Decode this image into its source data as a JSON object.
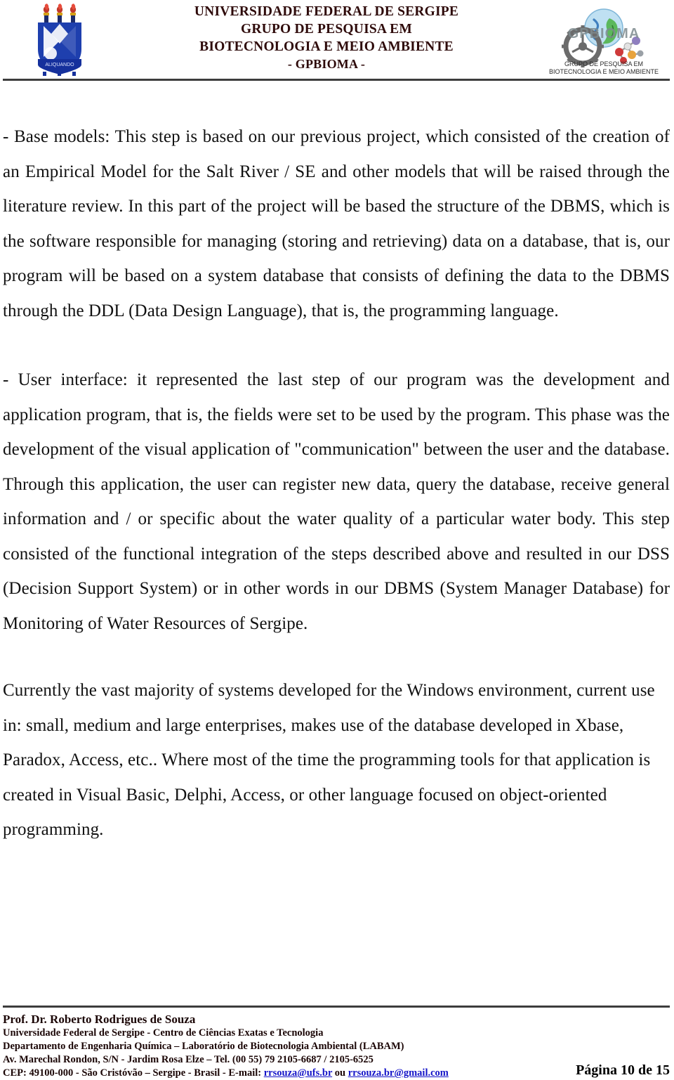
{
  "header": {
    "left_logo": "ufs-coat-of-arms-logo",
    "right_logo": "gpbioma-logo",
    "title_lines": [
      "UNIVERSIDADE FEDERAL DE SERGIPE",
      "GRUPO DE PESQUISA EM",
      "BIOTECNOLOGIA E MEIO AMBIENTE",
      "- GPBIOMA -"
    ],
    "title_color": "#2e0a0a",
    "rule_color": "#3d3d3d",
    "gpbioma_logo_text": {
      "wordmark": "GPBIOMA",
      "caption_line1": "GRUPO DE PESQUISA EM",
      "caption_line2": "BIOTECNOLOGIA E MEIO AMBIENTE"
    }
  },
  "body": {
    "paragraphs": [
      "- Base models: This step is based on our previous project, which consisted of the creation of an Empirical Model for the Salt River / SE and other models that will be raised through the literature review. In this part of the project will be based the structure of the DBMS, which is the software responsible for managing (storing and retrieving) data on a database, that is, our program will be based on a system database that consists of defining the data to the DBMS through the DDL (Data Design Language), that is, the programming language.",
      "- User interface: it represented the last step of our program was the development and application program, that is, the fields were set to be used by the program. This phase was the development of the visual application of \"communication\" between the user and the database. Through this application, the user can register new data, query the database, receive general information and / or specific about the water quality of a particular water body. This step consisted of the functional integration of the steps described above and resulted in our DSS (Decision Support System) or in other words in our DBMS (System Manager Database) for Monitoring of Water Resources of Sergipe.",
      "Currently the vast majority of systems developed for the Windows environment, current use in: small, medium and large enterprises, makes use of the database developed in Xbase, Paradox, Access, etc.. Where most of the time the programming tools for that application is created in Visual Basic, Delphi, Access, or other language focused on object-oriented programming."
    ]
  },
  "footer": {
    "name": "Prof. Dr. Roberto Rodrigues de Souza",
    "line1": "Universidade Federal de Sergipe - Centro de Ciências Exatas e Tecnologia",
    "line2": "Departamento de Engenharia Química – Laboratório de Biotecnologia Ambiental (LABAM)",
    "line3": "Av. Marechal Rondon, S/N - Jardim Rosa Elze – Tel. (00 55) 79 2105-6687 / 2105-6525",
    "line4_prefix": "CEP: 49100-000 - São Cristóvão – Sergipe - Brasil - E-mail: ",
    "email1": "rrsouza@ufs.br",
    "line4_middle": " ou ",
    "email2": "rrsouza.br@gmail.com",
    "page_number": "Página 10 de 15",
    "link_color": "#1414c8",
    "rule_color": "#3d3d3d"
  }
}
